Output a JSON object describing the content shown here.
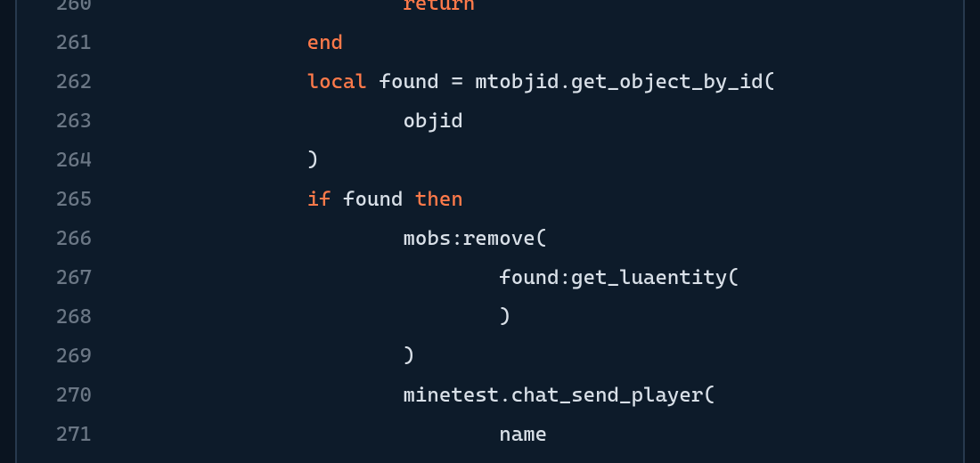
{
  "language": "lua",
  "first_line_number": 260,
  "lines": [
    {
      "n": 260,
      "indent": "                        ",
      "tokens": [
        {
          "t": "return",
          "k": "keyword"
        }
      ]
    },
    {
      "n": 261,
      "indent": "                ",
      "tokens": [
        {
          "t": "end",
          "k": "keyword"
        }
      ]
    },
    {
      "n": 262,
      "indent": "                ",
      "tokens": [
        {
          "t": "local",
          "k": "keyword"
        },
        {
          "t": " found = mtobjid.get_object_by_id(",
          "k": "default"
        }
      ]
    },
    {
      "n": 263,
      "indent": "                        ",
      "tokens": [
        {
          "t": "objid",
          "k": "default"
        }
      ]
    },
    {
      "n": 264,
      "indent": "                ",
      "tokens": [
        {
          "t": ")",
          "k": "default"
        }
      ]
    },
    {
      "n": 265,
      "indent": "                ",
      "tokens": [
        {
          "t": "if",
          "k": "keyword"
        },
        {
          "t": " found ",
          "k": "default"
        },
        {
          "t": "then",
          "k": "keyword"
        }
      ]
    },
    {
      "n": 266,
      "indent": "                        ",
      "tokens": [
        {
          "t": "mobs:remove(",
          "k": "default"
        }
      ]
    },
    {
      "n": 267,
      "indent": "                                ",
      "tokens": [
        {
          "t": "found:get_luaentity(",
          "k": "default"
        }
      ]
    },
    {
      "n": 268,
      "indent": "                                ",
      "tokens": [
        {
          "t": ")",
          "k": "default"
        }
      ]
    },
    {
      "n": 269,
      "indent": "                        ",
      "tokens": [
        {
          "t": ")",
          "k": "default"
        }
      ]
    },
    {
      "n": 270,
      "indent": "                        ",
      "tokens": [
        {
          "t": "minetest.chat_send_player(",
          "k": "default"
        }
      ]
    },
    {
      "n": 271,
      "indent": "                                ",
      "tokens": [
        {
          "t": "name",
          "k": "default"
        }
      ]
    }
  ]
}
